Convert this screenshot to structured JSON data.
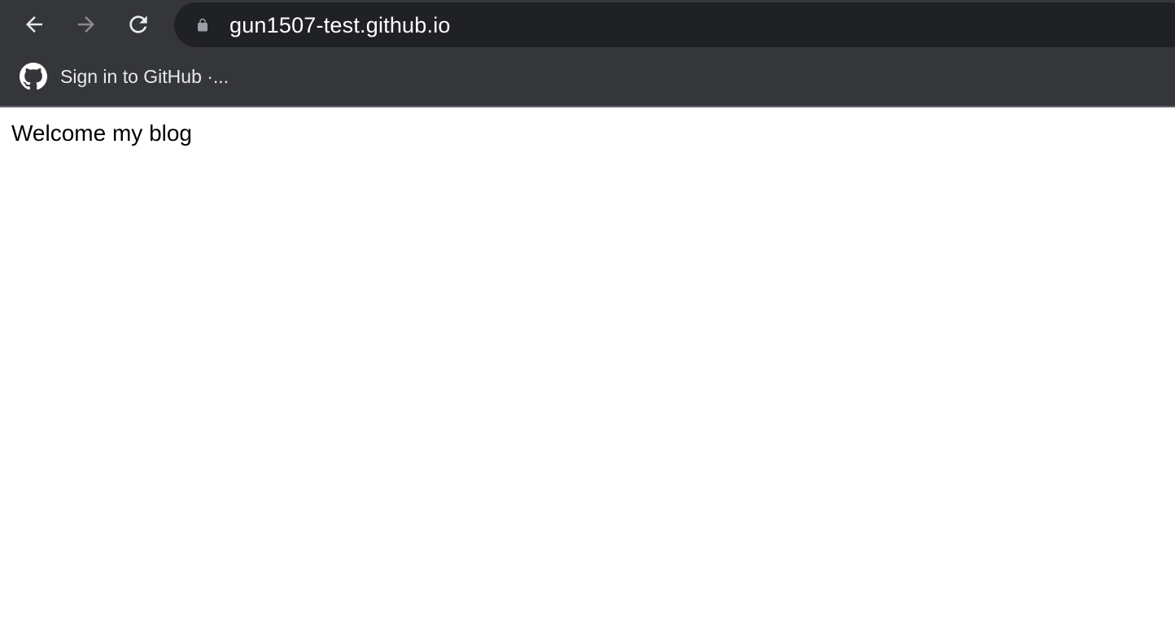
{
  "browser": {
    "nav": {
      "back_icon": "arrow-left-icon",
      "forward_icon": "arrow-right-icon",
      "reload_icon": "reload-icon"
    },
    "address_bar": {
      "lock_icon": "lock-icon",
      "url": "gun1507-test.github.io"
    },
    "bookmarks": [
      {
        "icon": "github-icon",
        "label": "Sign in to GitHub ·..."
      }
    ]
  },
  "page": {
    "heading": "Welcome my blog"
  },
  "colors": {
    "toolbar_bg": "#35363a",
    "omnibox_bg": "#202124",
    "text_light": "#e8eaed",
    "forward_disabled": "#8a8b8e",
    "page_bg": "#ffffff"
  }
}
